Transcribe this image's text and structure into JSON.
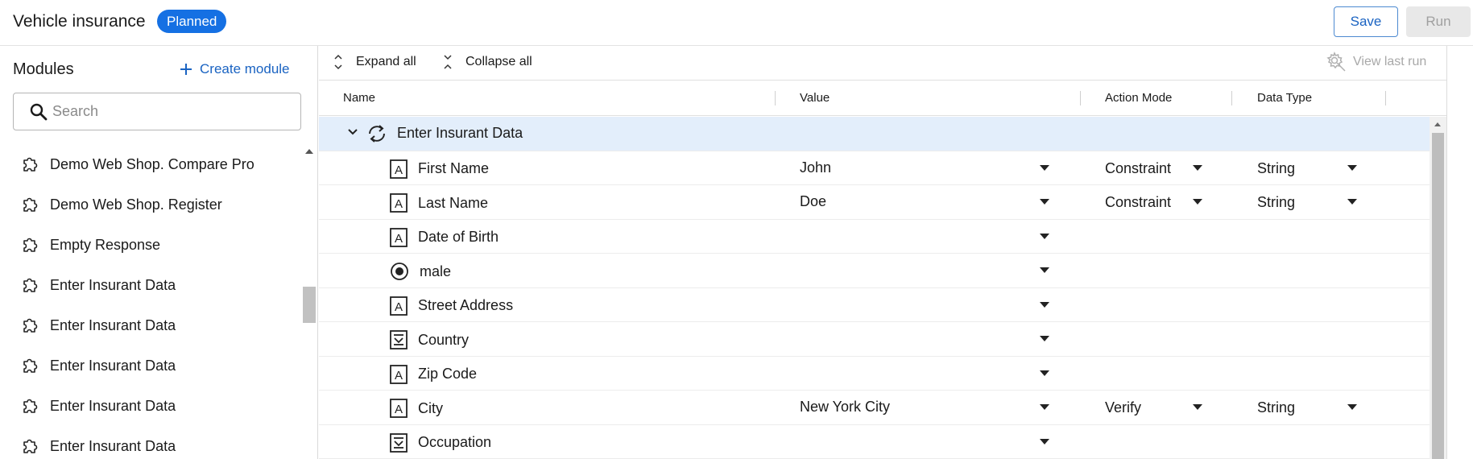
{
  "header": {
    "title": "Vehicle insurance",
    "status_badge": "Planned",
    "save_label": "Save",
    "run_label": "Run"
  },
  "sidebar": {
    "title": "Modules",
    "create_label": "Create module",
    "search_placeholder": "Search",
    "items": [
      {
        "label": "Demo Web Shop. Compare Pro"
      },
      {
        "label": "Demo Web Shop. Register"
      },
      {
        "label": "Empty Response"
      },
      {
        "label": "Enter Insurant Data"
      },
      {
        "label": "Enter Insurant Data"
      },
      {
        "label": "Enter Insurant Data"
      },
      {
        "label": "Enter Insurant Data"
      },
      {
        "label": "Enter Insurant Data"
      }
    ]
  },
  "toolbar": {
    "expand_all": "Expand all",
    "collapse_all": "Collapse all",
    "view_last_run": "View last run"
  },
  "table": {
    "columns": {
      "name": "Name",
      "value": "Value",
      "action_mode": "Action Mode",
      "data_type": "Data Type"
    },
    "group": {
      "label": "Enter Insurant Data",
      "expanded": true
    },
    "rows": [
      {
        "name": "First Name",
        "icon": "textbox-icon",
        "value": "John",
        "action_mode": "Constraint",
        "data_type": "String"
      },
      {
        "name": "Last Name",
        "icon": "textbox-icon",
        "value": "Doe",
        "action_mode": "Constraint",
        "data_type": "String"
      },
      {
        "name": "Date of Birth",
        "icon": "textbox-icon",
        "value": "",
        "action_mode": "",
        "data_type": ""
      },
      {
        "name": "male",
        "icon": "radio-icon",
        "value": "",
        "action_mode": "",
        "data_type": ""
      },
      {
        "name": "Street Address",
        "icon": "textbox-icon",
        "value": "",
        "action_mode": "",
        "data_type": ""
      },
      {
        "name": "Country",
        "icon": "combobox-icon",
        "value": "",
        "action_mode": "",
        "data_type": ""
      },
      {
        "name": "Zip Code",
        "icon": "textbox-icon",
        "value": "",
        "action_mode": "",
        "data_type": ""
      },
      {
        "name": "City",
        "icon": "textbox-icon",
        "value": "New York City",
        "action_mode": "Verify",
        "data_type": "String"
      },
      {
        "name": "Occupation",
        "icon": "combobox-icon",
        "value": "",
        "action_mode": "",
        "data_type": ""
      }
    ]
  },
  "colors": {
    "accent": "#1570e3",
    "link": "#1a63c2",
    "group_row_bg": "#e3eefb",
    "disabled": "#a0a0a0"
  }
}
